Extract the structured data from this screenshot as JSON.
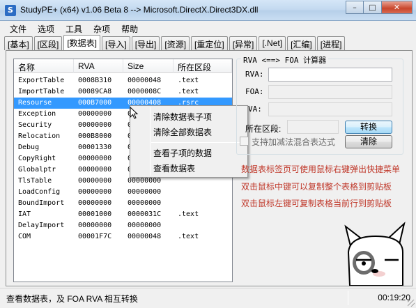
{
  "window": {
    "title": "StudyPE+ (x64) v1.06 Beta 8  --> Microsoft.DirectX.Direct3DX.dll",
    "minimize_glyph": "–",
    "maximize_glyph": "□",
    "close_glyph": "✕",
    "icon_letter": "S"
  },
  "menu": [
    "文件",
    "选项",
    "工具",
    "杂项",
    "帮助"
  ],
  "tabs": [
    "[基本]",
    "[区段]",
    "[数据表]",
    "[导入]",
    "[导出]",
    "[资源]",
    "[重定位]",
    "[异常]",
    "[.Net]",
    "[汇编]",
    "[进程]"
  ],
  "active_tab": 2,
  "table": {
    "columns": [
      "名称",
      "RVA",
      "Size",
      "所在区段"
    ],
    "rows": [
      [
        "ExportTable",
        "0008B310",
        "00000048",
        ".text"
      ],
      [
        "ImportTable",
        "00089CA8",
        "0000008C",
        ".text"
      ],
      [
        "Resourse",
        "000B7000",
        "00000408",
        ".rsrc"
      ],
      [
        "Exception",
        "00000000",
        "00000000",
        ""
      ],
      [
        "Security",
        "00000000",
        "00000000",
        ""
      ],
      [
        "Relocation",
        "000B8000",
        "0000000C",
        ""
      ],
      [
        "Debug",
        "00001330",
        "00000000",
        ""
      ],
      [
        "CopyRight",
        "00000000",
        "00000000",
        ""
      ],
      [
        "Globalptr",
        "00000000",
        "00000000",
        ""
      ],
      [
        "TlsTable",
        "00000000",
        "00000000",
        ""
      ],
      [
        "LoadConfig",
        "00000000",
        "00000000",
        ""
      ],
      [
        "BoundImport",
        "00000000",
        "00000000",
        ""
      ],
      [
        "IAT",
        "00001000",
        "0000031C",
        ".text"
      ],
      [
        "DelayImport",
        "00000000",
        "00000000",
        ""
      ],
      [
        "COM",
        "00001F7C",
        "00000048",
        ".text"
      ]
    ],
    "selected_row": 2
  },
  "context_menu": {
    "items": [
      "清除数据表子项",
      "清除全部数据表",
      "查看子项的数据",
      "查看数据表"
    ]
  },
  "calculator": {
    "title": "RVA <==> FOA 计算器",
    "rva_label": "RVA:",
    "foa_label": "FOA:",
    "va_label": "VA:",
    "section_label": "所在区段:",
    "rva_value": "",
    "foa_value": "",
    "va_value": "",
    "section_value": "",
    "convert_button": "转换",
    "clear_button": "清除",
    "checkbox_label": "支持加减法混合表达式",
    "checkbox_checked": false
  },
  "hints": [
    "数据表标签页可使用鼠标右键弹出快捷菜单",
    "双击鼠标中键可以复制整个表格到剪贴板",
    "双击鼠标左键可复制表格当前行到剪贴板"
  ],
  "status": {
    "text": "查看数据表，及 FOA RVA 相互转换",
    "time": "00:19:20"
  },
  "colors": {
    "hint_text": "#c0392b",
    "selection": "#3399ff"
  }
}
